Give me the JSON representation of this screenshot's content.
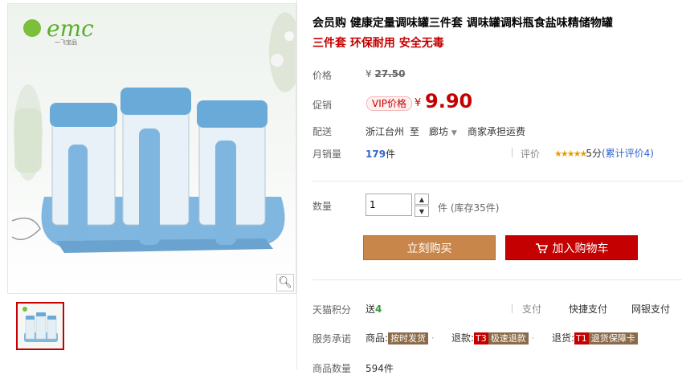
{
  "brand": {
    "logo_text": "emc",
    "logo_sub": "一飞宝品"
  },
  "product": {
    "title": "会员购 健康定量调味罐三件套 调味罐调料瓶食盐味精储物罐",
    "subtitle": "三件套 环保耐用 安全无毒"
  },
  "price": {
    "label": "价格",
    "currency": "¥",
    "original": "27.50",
    "promo_label": "促销",
    "vip_badge": "VIP价格",
    "promo_price": "9.90"
  },
  "delivery": {
    "label": "配送",
    "from": "浙江台州",
    "to_word": "至",
    "destination": "廊坊",
    "shipping": "商家承担运费"
  },
  "sales": {
    "label": "月销量",
    "count": "179",
    "unit": "件",
    "rating_label": "评价",
    "rating_stars": 5,
    "rating_text": "5分",
    "review_count": "(累计评价4)"
  },
  "quantity": {
    "label": "数量",
    "value": "1",
    "unit": "件",
    "stock": "(库存35件)"
  },
  "actions": {
    "buy_now": "立刻购买",
    "add_cart": "加入购物车"
  },
  "points": {
    "label": "天猫积分",
    "prefix": "送",
    "value": "4"
  },
  "payment": {
    "label": "支付",
    "options": [
      "快捷支付",
      "网银支付"
    ]
  },
  "service": {
    "label": "服务承诺",
    "items": [
      {
        "prefix": "商品:",
        "tag": "按时发货"
      },
      {
        "prefix": "退款:",
        "code": "T3",
        "tag": "极速退款"
      },
      {
        "prefix": "退货:",
        "code": "T1",
        "tag": "退货保障卡"
      }
    ]
  },
  "goods_count": {
    "label": "商品数量",
    "value": "594件"
  },
  "colors": {
    "accent": "#c40000",
    "buy_button": "#c9864a",
    "product_blue": "#6aaad8"
  }
}
